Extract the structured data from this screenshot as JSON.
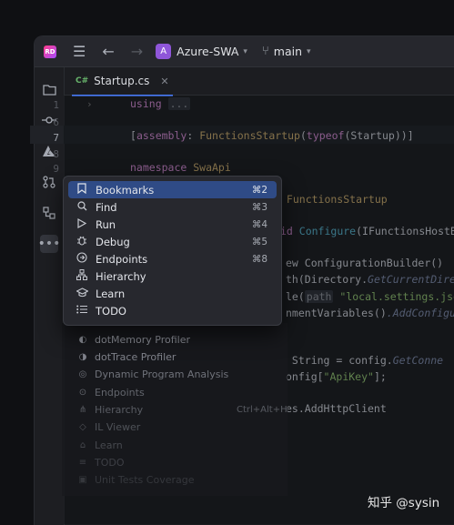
{
  "titlebar": {
    "app_logo": "RD",
    "menu_icon": "hamburger-menu-icon",
    "back_icon": "←",
    "forward_icon": "→",
    "project_badge": "A",
    "project_name": "Azure-SWA",
    "branch_name": "main"
  },
  "toolstrip": {
    "items": [
      "folder-icon",
      "commit-icon",
      "azure-icon",
      "pull-request-icon",
      "structure-icon",
      "more-icon"
    ]
  },
  "editor": {
    "tab_label": "Startup.cs",
    "tab_icon": "C#",
    "line_numbers": [
      "1",
      "6",
      "7",
      "8",
      "9"
    ],
    "lines": {
      "l1_kw": "using",
      "l1_fold": "...",
      "l7_a": "[",
      "l7_kw": "assembly",
      "l7_b": ": ",
      "l7_ty": "FunctionsStartup",
      "l7_c": "(",
      "l7_kw2": "typeof",
      "l7_d": "(Startup))]",
      "l9_kw": "namespace",
      "l9_name": " SwaApi",
      "frag1": " FunctionsStartup",
      "frag2_kw": "id ",
      "frag2_fn": "Configure",
      "frag2_rest": "(IFunctionsHostBu",
      "frag3": "ew ConfigurationBuilder()",
      "frag4_a": "th(Directory.",
      "frag4_it": "GetCurrentDirec",
      "frag5_a": "le(",
      "frag5_p": "path",
      "frag5_str": " \"local.settings.json\"",
      "frag6": "nmentVariables()",
      "frag6_it": ".AddConfigur",
      "frag7": " String = config.",
      "frag7_it": "GetConne",
      "frag8_a": "onfig[",
      "frag8_str": "\"ApiKey\"",
      "frag8_b": "];",
      "frag9": "es.AddHttpClient"
    }
  },
  "popup": {
    "items": [
      {
        "label": "Bookmarks",
        "shortcut": "⌘2",
        "icon": "bookmark-icon"
      },
      {
        "label": "Find",
        "shortcut": "⌘3",
        "icon": "search-icon"
      },
      {
        "label": "Run",
        "shortcut": "⌘4",
        "icon": "run-icon"
      },
      {
        "label": "Debug",
        "shortcut": "⌘5",
        "icon": "debug-icon"
      },
      {
        "label": "Endpoints",
        "shortcut": "⌘8",
        "icon": "endpoints-icon"
      },
      {
        "label": "Hierarchy",
        "shortcut": "",
        "icon": "hierarchy-icon"
      },
      {
        "label": "Learn",
        "shortcut": "",
        "icon": "learn-icon"
      },
      {
        "label": "TODO",
        "shortcut": "",
        "icon": "todo-icon"
      }
    ]
  },
  "background_menu": {
    "items": [
      {
        "label": "dotMemory Profiler",
        "shortcut": ""
      },
      {
        "label": "dotTrace Profiler",
        "shortcut": ""
      },
      {
        "label": "Dynamic Program Analysis",
        "shortcut": ""
      },
      {
        "label": "Endpoints",
        "shortcut": ""
      },
      {
        "label": "Hierarchy",
        "shortcut": "Ctrl+Alt+H"
      },
      {
        "label": "IL Viewer",
        "shortcut": ""
      },
      {
        "label": "Learn",
        "shortcut": ""
      },
      {
        "label": "TODO",
        "shortcut": ""
      },
      {
        "label": "Unit Tests Coverage",
        "shortcut": ""
      }
    ]
  },
  "watermark": "知乎 @sysin"
}
